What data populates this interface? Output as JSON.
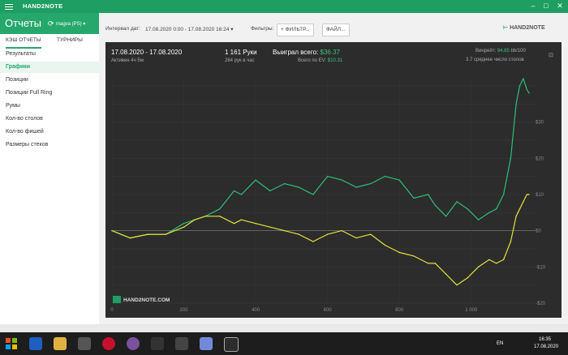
{
  "app": {
    "title": "HAND2NOTE"
  },
  "header": {
    "title": "Отчеты",
    "account": "magva (PS)"
  },
  "tabs": [
    {
      "label": "КЭШ ОТЧЕТЫ",
      "active": true
    },
    {
      "label": "ТУРНИРЫ",
      "active": false
    }
  ],
  "sidebar": {
    "items": [
      {
        "label": "Результаты"
      },
      {
        "label": "Графики",
        "active": true
      },
      {
        "label": "Позиции"
      },
      {
        "label": "Позиции Full Ring"
      },
      {
        "label": "Румы"
      },
      {
        "label": "Кол-во столов"
      },
      {
        "label": "Кол-во фишей"
      },
      {
        "label": "Размеры стеков"
      }
    ]
  },
  "filters": {
    "interval_label": "Интервал дат:",
    "interval_value": "17.08.2020 0:00 - 17.08.2020 16:24",
    "filters_label": "Фильтры:",
    "filter_button": "+ ФИЛЬТР...",
    "file_button": "ФАЙЛ...",
    "logo_text": "HAND2NOTE"
  },
  "stats": {
    "date_range": "17.08.2020 - 17.08.2020",
    "active": "Активен 4ч 5м",
    "hands": "1 161 Руки",
    "hands_per_hour": "284 рук в час",
    "won_label": "Выиграл всего:",
    "won_value": "$36.37",
    "ev_label": "Всего по EV:",
    "ev_value": "$10.31",
    "winrate_label": "Винрейт:",
    "winrate_value": "94.85",
    "winrate_suffix": "bb/100",
    "tables_avg": "3.7 среднее число столов"
  },
  "chart_data": {
    "type": "line",
    "x_ticks": [
      "0",
      "200",
      "400",
      "600",
      "800",
      "1 000"
    ],
    "y_ticks": [
      "$30",
      "$20",
      "$10",
      "$0",
      "-$10",
      "-$20"
    ],
    "xlim": [
      0,
      1161
    ],
    "ylim": [
      -20,
      42
    ],
    "legend_position": "bottom-right",
    "watermark": "HAND2NOTE.COM",
    "series": [
      {
        "name": "Выиграл всего",
        "color": "#2dbf7a",
        "x": [
          0,
          50,
          100,
          150,
          200,
          230,
          260,
          300,
          340,
          360,
          400,
          440,
          480,
          520,
          560,
          600,
          640,
          680,
          720,
          760,
          800,
          840,
          880,
          900,
          930,
          960,
          990,
          1020,
          1050,
          1070,
          1090,
          1110,
          1125,
          1135,
          1145,
          1155,
          1161
        ],
        "y": [
          0,
          -2,
          -1,
          -1,
          2,
          3,
          4,
          6,
          11,
          10,
          14,
          11,
          13,
          12,
          10,
          15,
          14,
          12,
          13,
          15,
          14,
          9,
          10,
          7,
          4,
          8,
          6,
          3,
          5,
          6,
          10,
          20,
          35,
          40,
          42,
          39,
          38
        ]
      },
      {
        "name": "Всего по EV",
        "color": "#e3e23a",
        "x": [
          0,
          50,
          100,
          150,
          200,
          230,
          260,
          300,
          340,
          360,
          400,
          440,
          480,
          520,
          560,
          600,
          640,
          680,
          720,
          760,
          800,
          840,
          880,
          900,
          930,
          960,
          990,
          1020,
          1050,
          1070,
          1090,
          1110,
          1125,
          1135,
          1145,
          1155,
          1161
        ],
        "y": [
          0,
          -2,
          -1,
          -1,
          1,
          3,
          4,
          4,
          2,
          3,
          2,
          1,
          0,
          -1,
          -3,
          -1,
          0,
          -2,
          -1,
          -4,
          -6,
          -7,
          -9,
          -9,
          -12,
          -15,
          -13,
          -10,
          -8,
          -9,
          -8,
          -3,
          4,
          6,
          8,
          10,
          10
        ]
      }
    ]
  },
  "taskbar": {
    "lang": "EN",
    "time": "16:35",
    "date": "17.08.2020"
  }
}
